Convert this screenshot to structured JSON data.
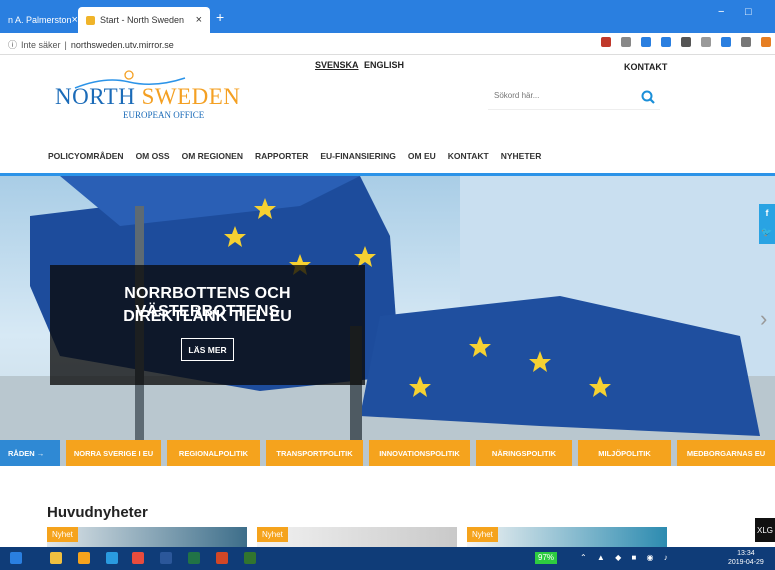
{
  "browser": {
    "tabs": [
      {
        "label": "n A. Palmerston",
        "active": false
      },
      {
        "label": "Start - North Sweden",
        "active": true
      }
    ],
    "tab_close": "×",
    "new_tab": "+",
    "window_min": "−",
    "window_max": "□",
    "security_label": "Inte säker",
    "url": "northsweden.utv.mirror.se",
    "extension_colors": [
      "#c0392b",
      "#888888",
      "#2a7fe0",
      "#2a7fe0",
      "#555555",
      "#999999",
      "#2a7fe0",
      "#777777",
      "#e67e22"
    ]
  },
  "header": {
    "lang_sv": "SVENSKA",
    "lang_en": "ENGLISH",
    "kontakt": "KONTAKT",
    "logo_north": "NORTH",
    "logo_sweden": "SWEDEN",
    "logo_sub": "EUROPEAN OFFICE",
    "search_placeholder": "Sökord här..."
  },
  "nav": {
    "items": [
      "POLICYOMRÅDEN",
      "OM OSS",
      "OM REGIONEN",
      "RAPPORTER",
      "EU-FINANSIERING",
      "OM EU",
      "KONTAKT",
      "NYHETER"
    ]
  },
  "hero": {
    "line1": "NORRBOTTENS OCH VÄSTERBOTTENS",
    "line2": "DIREKTLÄNK TILL EU",
    "button": "LÄS MER",
    "social_facebook": "f",
    "social_twitter": "🐦",
    "next_arrow": "›"
  },
  "topics": {
    "lead": "RÅDEN →",
    "items": [
      "NORRA SVERIGE I EU",
      "REGIONALPOLITIK",
      "TRANSPORTPOLITIK",
      "INNOVATIONSPOLITIK",
      "NÄRINGSPOLITIK",
      "MILJÖPOLITIK",
      "MEDBORGARNAS EU"
    ]
  },
  "news": {
    "heading": "Huvudnyheter",
    "tag": "Nyhet"
  },
  "overlay": {
    "xlg": "XLG"
  },
  "taskbar": {
    "battery": "97%",
    "time": "13:34",
    "date": "2019-04-29"
  }
}
